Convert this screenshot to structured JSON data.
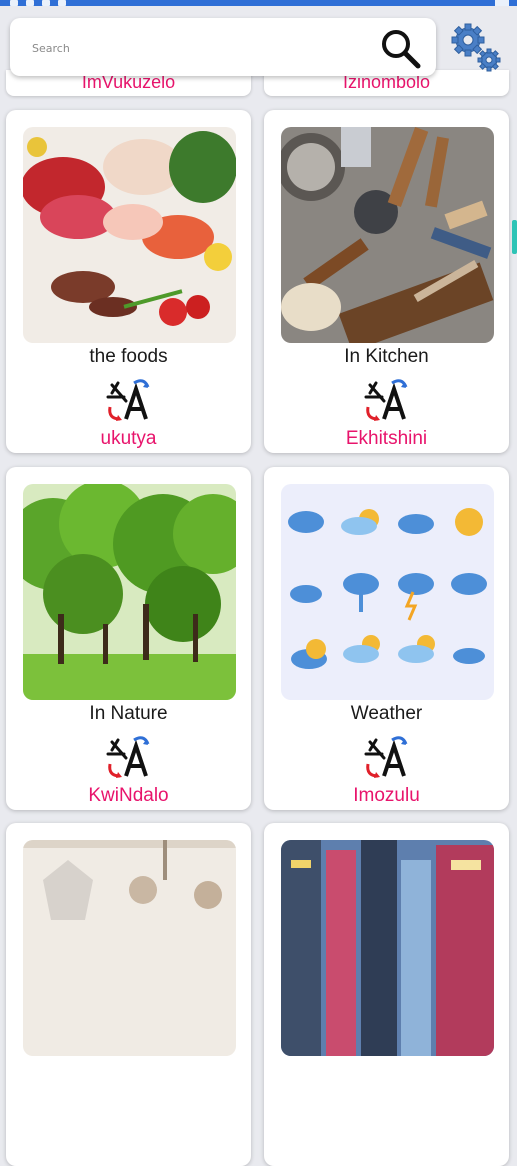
{
  "search": {
    "placeholder": "Search"
  },
  "header": {
    "search_icon": "search-icon",
    "settings_icon": "gear-icon"
  },
  "top_partial": [
    {
      "label": "ImVukuzelo"
    },
    {
      "label": "Izinombolo"
    }
  ],
  "categories": [
    {
      "title": "the foods",
      "translation": "ukutya",
      "icon": "food-image"
    },
    {
      "title": "In Kitchen",
      "translation": "Ekhitshini",
      "icon": "kitchen-image"
    },
    {
      "title": "In Nature",
      "translation": "KwiNdalo",
      "icon": "nature-image"
    },
    {
      "title": "Weather",
      "translation": "Imozulu",
      "icon": "weather-image"
    },
    {
      "title": "",
      "translation": "",
      "icon": "clothes-image"
    },
    {
      "title": "",
      "translation": "",
      "icon": "city-image"
    }
  ],
  "colors": {
    "accent": "#e8146c",
    "background": "#e9eaef",
    "status_bar": "#2f6fd6"
  }
}
